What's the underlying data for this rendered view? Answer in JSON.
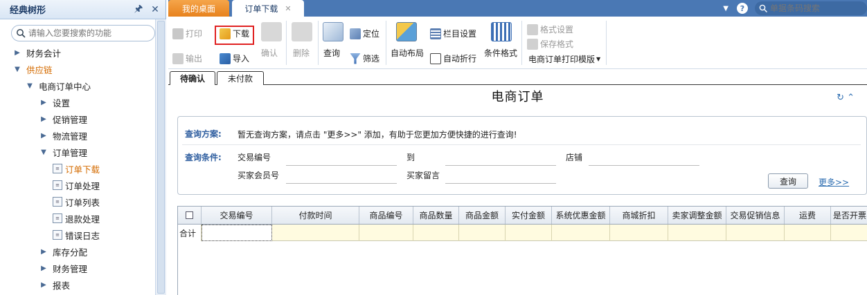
{
  "sidebar": {
    "title": "经典树形",
    "pin_icon": "pin-icon",
    "close_icon": "close-icon",
    "search_placeholder": "请输入您要搜索的功能",
    "tree": [
      {
        "label": "财务会计",
        "level": 1,
        "expanded": false
      },
      {
        "label": "供应链",
        "level": 1,
        "expanded": true
      },
      {
        "label": "电商订单中心",
        "level": 2,
        "expanded": true
      },
      {
        "label": "设置",
        "level": 3,
        "expanded": false
      },
      {
        "label": "促销管理",
        "level": 3,
        "expanded": false
      },
      {
        "label": "物流管理",
        "level": 3,
        "expanded": false
      },
      {
        "label": "订单管理",
        "level": 3,
        "expanded": true
      },
      {
        "label": "订单下载",
        "level": 4,
        "leaf": true,
        "active": true
      },
      {
        "label": "订单处理",
        "level": 4,
        "leaf": true
      },
      {
        "label": "订单列表",
        "level": 4,
        "leaf": true
      },
      {
        "label": "退款处理",
        "level": 4,
        "leaf": true
      },
      {
        "label": "错误日志",
        "level": 4,
        "leaf": true
      },
      {
        "label": "库存分配",
        "level": 3,
        "expanded": false
      },
      {
        "label": "财务管理",
        "level": 3,
        "expanded": false
      },
      {
        "label": "报表",
        "level": 3,
        "expanded": false
      }
    ]
  },
  "tabs": {
    "desk": "我的桌面",
    "order": "订单下载"
  },
  "barcode_placeholder": "单据条码搜索",
  "toolbar": {
    "print": "打印",
    "download": "下载",
    "export": "输出",
    "import": "导入",
    "confirm": "确认",
    "delete": "删除",
    "query": "查询",
    "locate": "定位",
    "filter": "筛选",
    "auto_layout": "自动布局",
    "column_settings": "栏目设置",
    "auto_wrap": "自动折行",
    "conditional_format": "条件格式",
    "format_settings": "格式设置",
    "save_format": "保存格式",
    "print_template": "电商订单打印模版"
  },
  "subtabs": [
    "待确认",
    "未付款"
  ],
  "page_title": "电商订单",
  "query": {
    "scheme_label": "查询方案:",
    "scheme_text": "暂无查询方案，请点击 \"更多>>\" 添加，有助于您更加方便快捷的进行查询!",
    "cond_label": "查询条件:",
    "trade_no": "交易编号",
    "to": "到",
    "shop": "店铺",
    "buyer_id": "买家会员号",
    "buyer_msg": "买家留言",
    "query_button": "查询",
    "more": "更多>>"
  },
  "grid": {
    "columns": [
      "交易编号",
      "付款时间",
      "商品编号",
      "商品数量",
      "商品金额",
      "实付金额",
      "系统优惠金额",
      "商城折扣",
      "卖家调整金额",
      "交易促销信息",
      "运费",
      "是否开票"
    ],
    "summary_label": "合计"
  }
}
